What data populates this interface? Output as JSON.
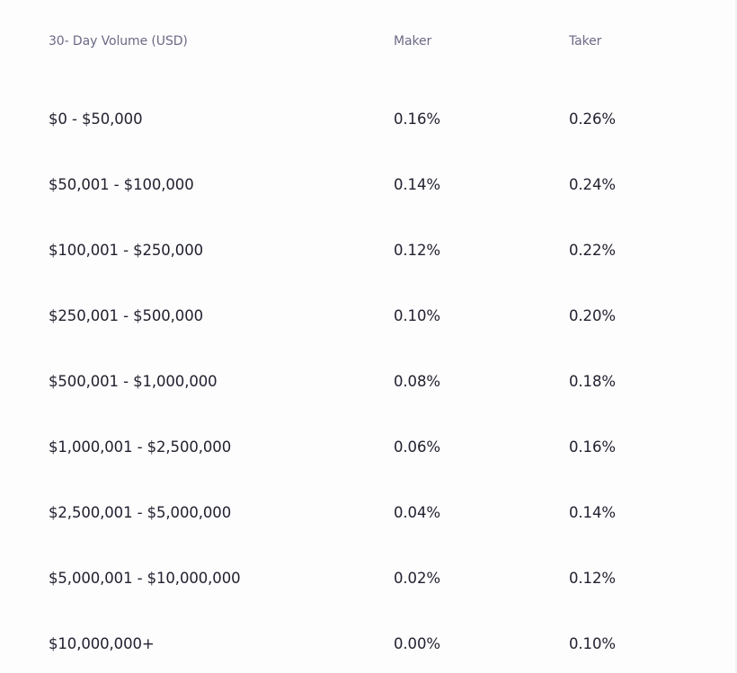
{
  "fee_table": {
    "headers": {
      "volume": "30- Day Volume (USD)",
      "maker": "Maker",
      "taker": "Taker"
    },
    "rows": [
      {
        "volume": "$0 - $50,000",
        "maker": "0.16%",
        "taker": "0.26%"
      },
      {
        "volume": "$50,001 - $100,000",
        "maker": "0.14%",
        "taker": "0.24%"
      },
      {
        "volume": "$100,001 - $250,000",
        "maker": "0.12%",
        "taker": "0.22%"
      },
      {
        "volume": "$250,001 - $500,000",
        "maker": "0.10%",
        "taker": "0.20%"
      },
      {
        "volume": "$500,001 - $1,000,000",
        "maker": "0.08%",
        "taker": "0.18%"
      },
      {
        "volume": "$1,000,001 - $2,500,000",
        "maker": "0.06%",
        "taker": "0.16%"
      },
      {
        "volume": "$2,500,001 - $5,000,000",
        "maker": "0.04%",
        "taker": "0.14%"
      },
      {
        "volume": "$5,000,001 - $10,000,000",
        "maker": "0.02%",
        "taker": "0.12%"
      },
      {
        "volume": "$10,000,000+",
        "maker": "0.00%",
        "taker": "0.10%"
      }
    ]
  }
}
